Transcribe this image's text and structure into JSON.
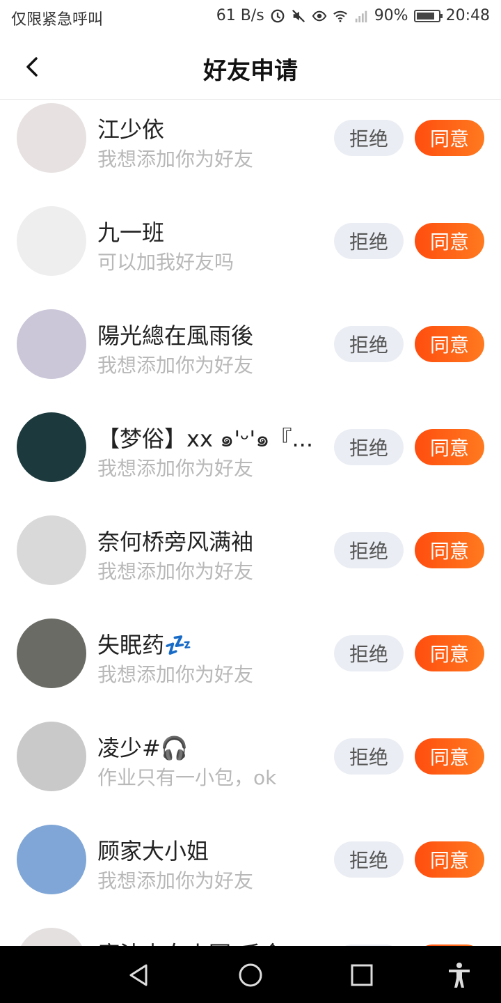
{
  "status_bar": {
    "left_text": "仅限紧急呼叫",
    "speed": "61 B/s",
    "battery": "90%",
    "battery_level": 0.9,
    "time": "20:48"
  },
  "header": {
    "title": "好友申请"
  },
  "buttons": {
    "reject": "拒绝",
    "agree": "同意"
  },
  "requests": [
    {
      "name": "江少依",
      "message": "我想添加你为好友",
      "avatar_color": "#e7e1e1"
    },
    {
      "name": "九一班",
      "message": "可以加我好友吗",
      "avatar_color": "#eeeeee"
    },
    {
      "name": "陽光總在風雨後",
      "message": "我想添加你为好友",
      "avatar_color": "#cbc6d8"
    },
    {
      "name": "【梦俗】xx ๑'ᵕ'๑『...",
      "message": "我想添加你为好友",
      "avatar_color": "#1c3a3d"
    },
    {
      "name": "奈何桥旁风满袖",
      "message": "我想添加你为好友",
      "avatar_color": "#d9d9d9"
    },
    {
      "name": "失眠药💤",
      "message": "我想添加你为好友",
      "avatar_color": "#6b6b66"
    },
    {
      "name": "凌少#🎧",
      "message": "作业只有一小包，ok",
      "avatar_color": "#c9c9c9"
    },
    {
      "name": "顾家大小姐",
      "message": "我想添加你为好友",
      "avatar_color": "#7fa6d6"
    },
    {
      "name": "魔法少女小圆-千金",
      "message": "",
      "avatar_color": "#e5e0e0"
    }
  ]
}
